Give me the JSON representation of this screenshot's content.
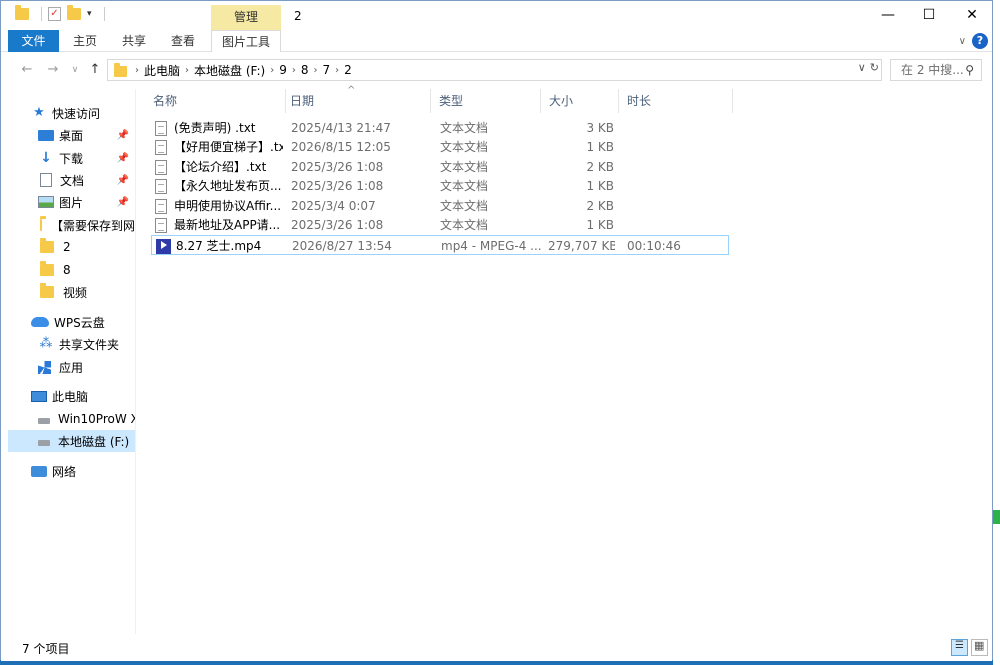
{
  "window": {
    "title": "2",
    "manage_tab": "管理",
    "min": "—",
    "max": "☐",
    "close": "✕"
  },
  "ribbon": {
    "tabs": [
      "文件",
      "主页",
      "共享",
      "查看",
      "图片工具"
    ]
  },
  "address": {
    "crumbs": [
      "此电脑",
      "本地磁盘 (F:)",
      "9",
      "8",
      "7",
      "2"
    ],
    "search_placeholder": "在 2 中搜..."
  },
  "sidebar": {
    "items": [
      {
        "label": "快速访问",
        "icon": "star-icon"
      },
      {
        "label": "桌面",
        "icon": "desktop-icon",
        "pinned": true
      },
      {
        "label": "下载",
        "icon": "download-icon",
        "pinned": true
      },
      {
        "label": "文档",
        "icon": "document-icon",
        "pinned": true
      },
      {
        "label": "图片",
        "icon": "picture-icon",
        "pinned": true
      },
      {
        "label": "【需要保存到网",
        "icon": "folder-icon"
      },
      {
        "label": "2",
        "icon": "folder-icon"
      },
      {
        "label": "8",
        "icon": "folder-icon"
      },
      {
        "label": "视频",
        "icon": "folder-icon"
      },
      {
        "label": "WPS云盘",
        "icon": "cloud-icon"
      },
      {
        "label": "共享文件夹",
        "icon": "share-icon"
      },
      {
        "label": "应用",
        "icon": "apps-icon"
      },
      {
        "label": "此电脑",
        "icon": "computer-icon"
      },
      {
        "label": "Win10ProW X",
        "icon": "drive-icon"
      },
      {
        "label": "本地磁盘 (F:)",
        "icon": "drive-icon",
        "selected": true
      },
      {
        "label": "网络",
        "icon": "network-icon"
      }
    ]
  },
  "columns": [
    "名称",
    "日期",
    "类型",
    "大小",
    "时长"
  ],
  "files": [
    {
      "name": "(免责声明) .txt",
      "date": "2025/4/13 21:47",
      "type": "文本文档",
      "size": "3 KB",
      "duration": "",
      "icon": "text-file-icon"
    },
    {
      "name": "【好用便宜梯子】.txt",
      "date": "2026/8/15 12:05",
      "type": "文本文档",
      "size": "1 KB",
      "duration": "",
      "icon": "text-file-icon"
    },
    {
      "name": "【论坛介绍】.txt",
      "date": "2025/3/26 1:08",
      "type": "文本文档",
      "size": "2 KB",
      "duration": "",
      "icon": "text-file-icon"
    },
    {
      "name": "【永久地址发布页...",
      "date": "2025/3/26 1:08",
      "type": "文本文档",
      "size": "1 KB",
      "duration": "",
      "icon": "text-file-icon"
    },
    {
      "name": "申明使用协议Affir...",
      "date": "2025/3/4 0:07",
      "type": "文本文档",
      "size": "2 KB",
      "duration": "",
      "icon": "text-file-icon"
    },
    {
      "name": "最新地址及APP请...",
      "date": "2025/3/26 1:08",
      "type": "文本文档",
      "size": "1 KB",
      "duration": "",
      "icon": "text-file-icon"
    },
    {
      "name": "8.27 芝士.mp4",
      "date": "2026/8/27 13:54",
      "type": "mp4 - MPEG-4 ...",
      "size": "279,707 KB",
      "duration": "00:10:46",
      "icon": "video-file-icon"
    }
  ],
  "status": {
    "count": "7 个项目"
  }
}
